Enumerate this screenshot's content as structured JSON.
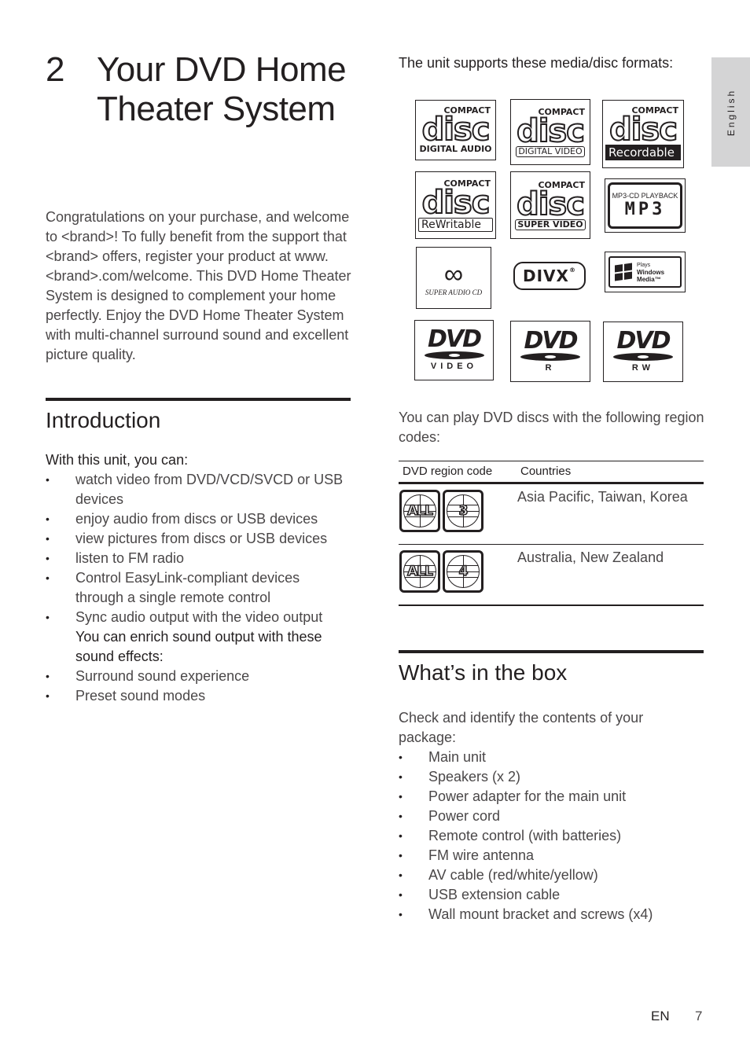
{
  "chapter": {
    "number": "2",
    "title": "Your DVD Home Theater System"
  },
  "language_tab": "English",
  "intro_paragraph": "Congratulations on your purchase, and welcome to <brand>! To fully benefit from the support that <brand> offers, register your product at www.<brand>.com/welcome. This DVD Home Theater System is designed to complement your home perfectly. Enjoy the DVD Home Theater System with multi-channel surround sound and excellent picture quality.",
  "introduction": {
    "title": "Introduction",
    "lead": "With this unit, you can:",
    "items": [
      "watch video from DVD/VCD/SVCD or USB devices",
      "enjoy audio from discs or USB devices",
      "view pictures from discs or USB devices",
      "listen to FM radio",
      "Control EasyLink-compliant devices through a single remote control",
      "Sync audio output with the video output"
    ],
    "sound_lead": "You can enrich sound output with these sound effects:",
    "sound_items": [
      "Surround sound experience",
      "Preset sound modes"
    ]
  },
  "formats": {
    "caption": "The unit supports these media/disc formats:",
    "logos": [
      {
        "compact": "COMPACT",
        "disc": "disc",
        "sub": "DIGITAL AUDIO"
      },
      {
        "compact": "COMPACT",
        "disc": "disc",
        "sub": "DIGITAL VIDEO"
      },
      {
        "compact": "COMPACT",
        "disc": "disc",
        "sub": "Recordable"
      },
      {
        "compact": "COMPACT",
        "disc": "disc",
        "sub": "ReWritable"
      },
      {
        "compact": "COMPACT",
        "disc": "disc",
        "sub": "SUPER VIDEO"
      },
      {
        "caption": "MP3-CD PLAYBACK",
        "big": "MP3"
      },
      {
        "symbol": "∞",
        "sub": "SUPER AUDIO CD"
      },
      {
        "word": "DIVX",
        "reg": "®"
      },
      {
        "line1": "Plays",
        "line2": "Windows",
        "line3": "Media™",
        "tm": "TM"
      },
      {
        "word": "DVD",
        "sub": "VIDEO"
      },
      {
        "word": "DVD",
        "sub": "R"
      },
      {
        "word": "DVD",
        "sub": "RW"
      }
    ]
  },
  "region": {
    "caption": "You can play DVD discs with the following region codes:",
    "headers": [
      "DVD region code",
      "Countries"
    ],
    "rows": [
      {
        "codes": [
          "ALL",
          "3"
        ],
        "countries": "Asia Pacific, Taiwan, Korea"
      },
      {
        "codes": [
          "ALL",
          "4"
        ],
        "countries": "Australia, New Zealand"
      }
    ]
  },
  "box": {
    "title": "What’s in the box",
    "lead": "Check and identify the contents of your package:",
    "items": [
      "Main unit",
      "Speakers (x 2)",
      "Power adapter for the main unit",
      "Power cord",
      "Remote control (with batteries)",
      "FM wire antenna",
      "AV cable (red/white/yellow)",
      "USB extension cable",
      "Wall mount bracket and screws (x4)"
    ]
  },
  "footer": {
    "lang": "EN",
    "page": "7"
  }
}
